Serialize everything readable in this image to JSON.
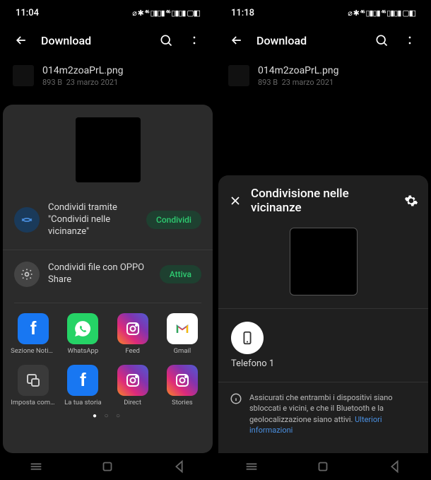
{
  "left": {
    "status": {
      "time": "11:04",
      "icons": "⌀ ✱ ⁴⁶ ▯▮▯▮ ⁴⁶ ▯▮▯▮ ▢◧"
    },
    "appbar": {
      "title": "Download"
    },
    "file": {
      "name": "014m2zoaPrL.png",
      "size": "893 B",
      "date": "23 marzo 2021"
    },
    "sheet": {
      "nearby": {
        "line1": "Condividi tramite",
        "line2": "\"Condividi nelle vicinanze\"",
        "button": "Condividi"
      },
      "oppo": {
        "label": "Condividi file con OPPO Share",
        "button": "Attiva"
      },
      "apps": [
        {
          "label": "Sezione Notizie",
          "kind": "fb"
        },
        {
          "label": "WhatsApp",
          "kind": "wa"
        },
        {
          "label": "Feed",
          "kind": "ig"
        },
        {
          "label": "Gmail",
          "kind": "gm"
        },
        {
          "label": "Imposta come immagine del ...",
          "kind": "gen"
        },
        {
          "label": "La tua storia",
          "kind": "fb"
        },
        {
          "label": "Direct",
          "kind": "ig"
        },
        {
          "label": "Stories",
          "kind": "ig"
        }
      ]
    }
  },
  "right": {
    "status": {
      "time": "11:18",
      "icons": "⌀ ✱ ⁴⁶ ▯▮▯▮ ⁴⁶ ▯▮▯▮ ▢◧"
    },
    "appbar": {
      "title": "Download"
    },
    "file": {
      "name": "014m2zoaPrL.png",
      "size": "893 B",
      "date": "23 marzo 2021"
    },
    "panel": {
      "title": "Condivisione nelle vicinanze",
      "device": "Telefono 1",
      "info": "Assicurati che entrambi i dispositivi siano sbloccati e vicini, e che il Bluetooth e la geolocalizzazione siano attivi.",
      "info_link": "Ulteriori informazioni"
    }
  }
}
